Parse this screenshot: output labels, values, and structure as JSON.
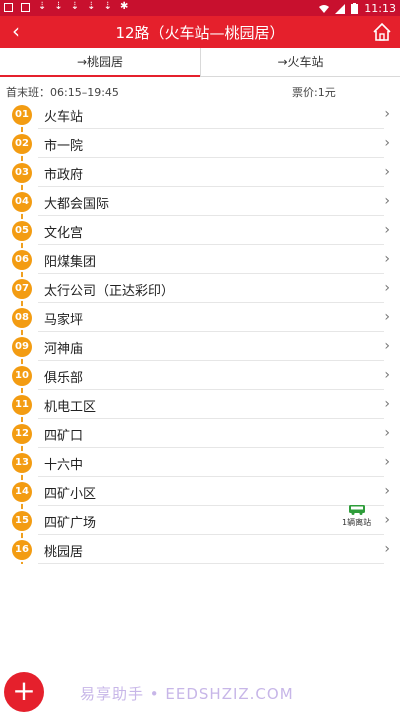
{
  "statusbar": {
    "time": "11:13"
  },
  "header": {
    "title": "12路（火车站—桃园居）"
  },
  "tabs": [
    {
      "label": "→桃园居"
    },
    {
      "label": "→火车站"
    }
  ],
  "info": {
    "times": "首末班：06:15–19:45",
    "fare": "票价:1元"
  },
  "stops": [
    {
      "no": "01",
      "name": "火车站"
    },
    {
      "no": "02",
      "name": "市一院"
    },
    {
      "no": "03",
      "name": "市政府"
    },
    {
      "no": "04",
      "name": "大都会国际"
    },
    {
      "no": "05",
      "name": "文化宫"
    },
    {
      "no": "06",
      "name": "阳煤集团"
    },
    {
      "no": "07",
      "name": "太行公司（正达彩印）"
    },
    {
      "no": "08",
      "name": "马家坪"
    },
    {
      "no": "09",
      "name": "河神庙"
    },
    {
      "no": "10",
      "name": "俱乐部"
    },
    {
      "no": "11",
      "name": "机电工区"
    },
    {
      "no": "12",
      "name": "四矿口"
    },
    {
      "no": "13",
      "name": "十六中"
    },
    {
      "no": "14",
      "name": "四矿小区"
    },
    {
      "no": "15",
      "name": "四矿广场",
      "bus_label": "1辆离站"
    },
    {
      "no": "16",
      "name": "桃园居"
    }
  ],
  "colors": {
    "header": "#e5202c",
    "statusbar": "#c8102e",
    "badge": "#f39c12",
    "bus": "#2e9d3a"
  },
  "fab": {
    "label": "+"
  },
  "watermark": "易享助手 • EEDSHZIZ.COM"
}
